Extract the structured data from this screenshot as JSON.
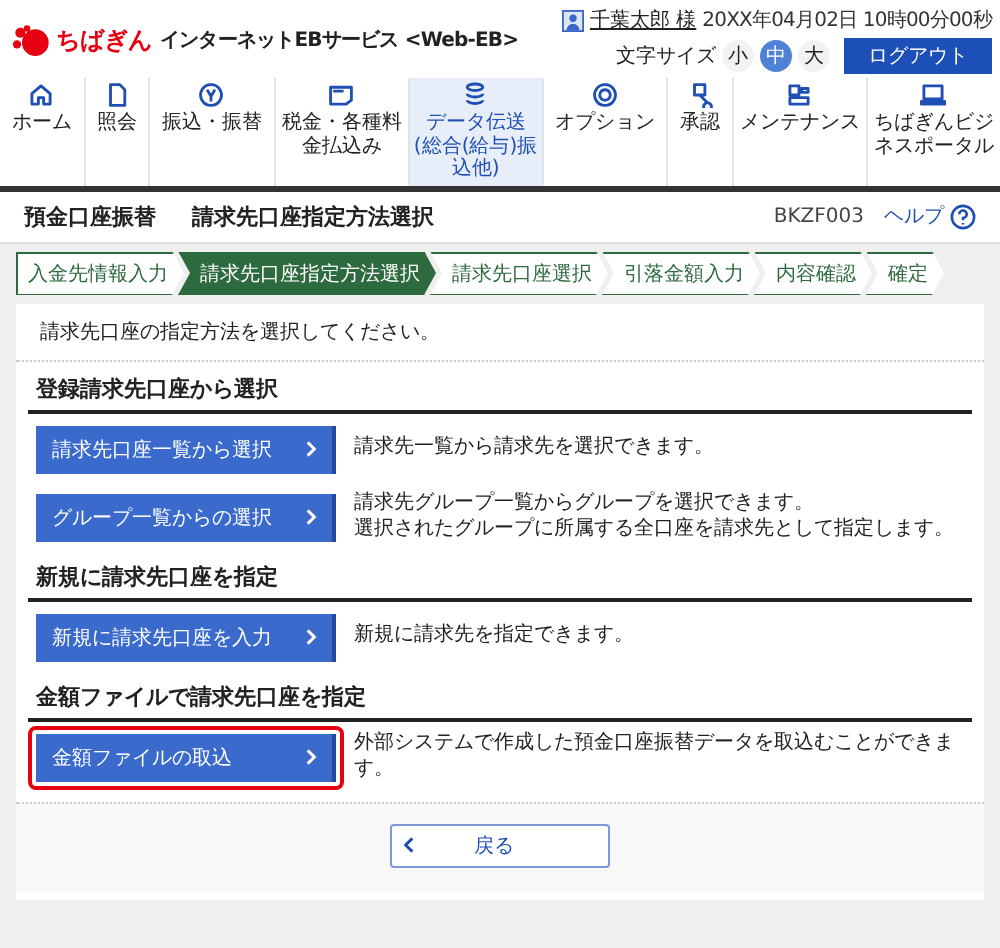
{
  "header": {
    "logo_text": "ちばぎん",
    "service_name": "インターネットEBサービス <Web-EB>",
    "user_name": "千葉太郎 様",
    "datetime": "20XX年04月02日 10時00分00秒",
    "font_size_label": "文字サイズ",
    "font_sizes": [
      {
        "label": "小",
        "selected": false
      },
      {
        "label": "中",
        "selected": true
      },
      {
        "label": "大",
        "selected": false
      }
    ],
    "logout": "ログアウト"
  },
  "nav": [
    {
      "label": "ホーム",
      "selected": false
    },
    {
      "label": "照会",
      "selected": false
    },
    {
      "label": "振込・振替",
      "selected": false
    },
    {
      "label": "税金・各種料金払込み",
      "selected": false
    },
    {
      "label": "データ伝送",
      "sublabel": "(総合(給与)振込他)",
      "selected": true
    },
    {
      "label": "オプション",
      "selected": false
    },
    {
      "label": "承認",
      "selected": false
    },
    {
      "label": "メンテナンス",
      "selected": false
    },
    {
      "label": "ちばぎんビジネスポータル",
      "selected": false
    }
  ],
  "title_bar": {
    "category": "預金口座振替",
    "title": "請求先口座指定方法選択",
    "screen_id": "BKZF003",
    "help": "ヘルプ"
  },
  "steps": [
    {
      "label": "入金先情報入力",
      "selected": false
    },
    {
      "label": "請求先口座指定方法選択",
      "selected": true
    },
    {
      "label": "請求先口座選択",
      "selected": false
    },
    {
      "label": "引落金額入力",
      "selected": false
    },
    {
      "label": "内容確認",
      "selected": false
    },
    {
      "label": "確定",
      "selected": false
    }
  ],
  "intro": "請求先口座の指定方法を選択してください。",
  "sections": [
    {
      "heading": "登録請求先口座から選択",
      "options": [
        {
          "label": "請求先口座一覧から選択",
          "description": [
            "請求先一覧から請求先を選択できます。"
          ],
          "highlighted": false
        },
        {
          "label": "グループ一覧からの選択",
          "description": [
            "請求先グループ一覧からグループを選択できます。",
            "選択されたグループに所属する全口座を請求先として指定します。"
          ],
          "highlighted": false
        }
      ]
    },
    {
      "heading": "新規に請求先口座を指定",
      "options": [
        {
          "label": "新規に請求先口座を入力",
          "description": [
            "新規に請求先を指定できます。"
          ],
          "highlighted": false
        }
      ]
    },
    {
      "heading": "金額ファイルで請求先口座を指定",
      "options": [
        {
          "label": "金額ファイルの取込",
          "description": [
            "外部システムで作成した預金口座振替データを取込むことができます。"
          ],
          "highlighted": true
        }
      ]
    }
  ],
  "back_button": "戻る"
}
